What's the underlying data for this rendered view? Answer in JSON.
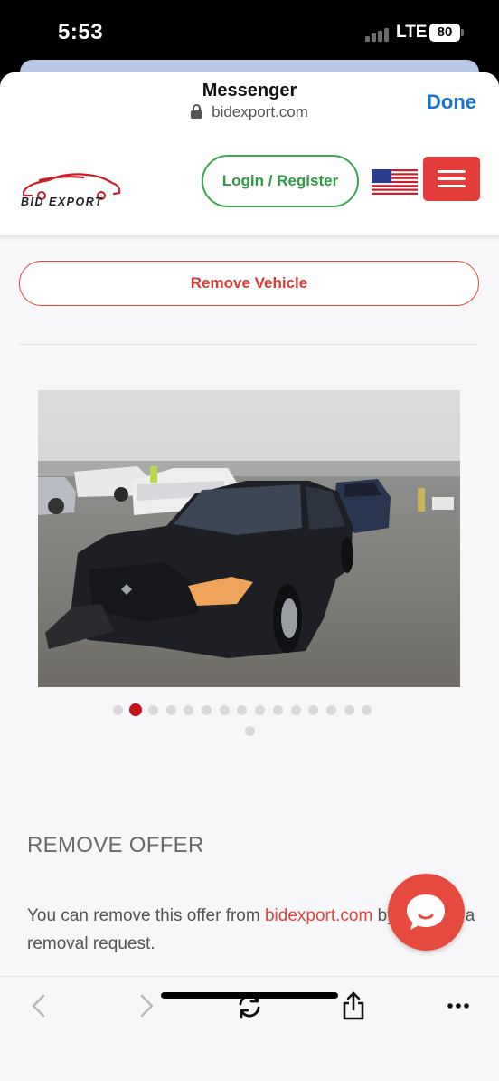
{
  "status_bar": {
    "time": "5:53",
    "network": "LTE",
    "battery": "80"
  },
  "browser": {
    "title": "Messenger",
    "url": "bidexport.com",
    "done_label": "Done"
  },
  "site_header": {
    "logo_text": "BID EXPORT",
    "login_label": "Login / Register",
    "flag": "us-flag-icon",
    "menu_icon": "hamburger-menu-icon"
  },
  "page": {
    "remove_vehicle_label": "Remove Vehicle",
    "gallery": {
      "image_alt": "Damaged black Toyota Camry in a salvage lot",
      "dot_count": 16,
      "active_index": 1
    },
    "remove_offer": {
      "heading": "REMOVE OFFER",
      "text_before": "You can remove this offer from ",
      "link_text": "bidexport.com",
      "text_after": " by sending a removal request."
    }
  },
  "toolbar": {
    "items": [
      "back-arrow-icon",
      "forward-arrow-icon",
      "reload-icon",
      "share-icon",
      "more-icon"
    ]
  },
  "colors": {
    "brand_red": "#e43b3b",
    "login_green": "#3aa64f",
    "link_blue": "#1a73d0"
  }
}
